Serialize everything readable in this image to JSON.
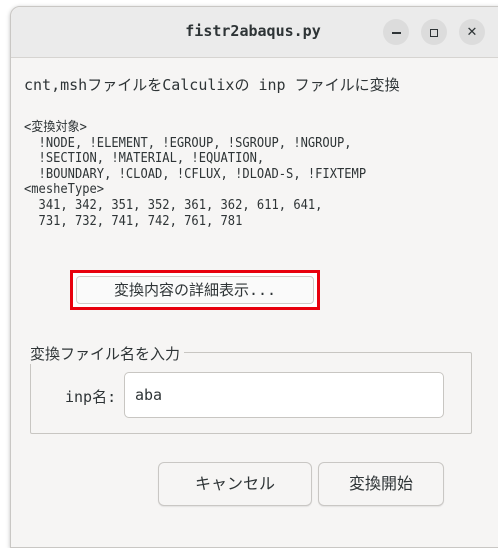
{
  "window": {
    "title": "fistr2abaqus.py"
  },
  "heading": "cnt,mshファイルをCalculixの inp ファイルに変換",
  "description": {
    "lines": [
      "<変換対象>",
      "  !NODE, !ELEMENT, !EGROUP, !SGROUP, !NGROUP,",
      "  !SECTION, !MATERIAL, !EQUATION,",
      "  !BOUNDARY, !CLOAD, !CFLUX, !DLOAD-S, !FIXTEMP",
      "<mesheType>",
      "  341, 342, 351, 352, 361, 362, 611, 641,",
      "  731, 732, 741, 742, 761, 781"
    ]
  },
  "detail_button": {
    "label": "変換内容の詳細表示..."
  },
  "file_group": {
    "label": "変換ファイル名を入力",
    "inp_label": "inp名:",
    "inp_value": "aba"
  },
  "buttons": {
    "cancel": "キャンセル",
    "start": "変換開始"
  },
  "colors": {
    "highlight": "#e8000d",
    "window_bg": "#f6f5f4",
    "titlebar_bg": "#ebebeb"
  }
}
